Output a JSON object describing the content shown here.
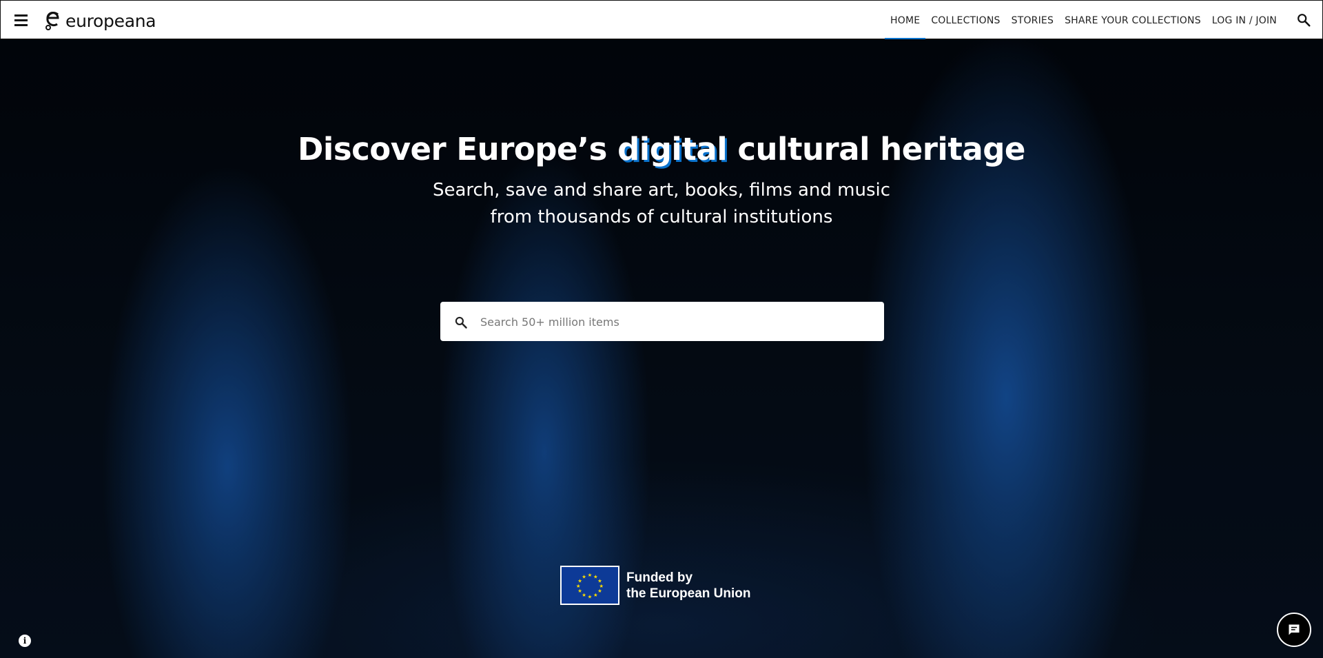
{
  "header": {
    "logo_text": "europeana",
    "nav": [
      {
        "label": "HOME",
        "active": true
      },
      {
        "label": "COLLECTIONS",
        "active": false
      },
      {
        "label": "STORIES",
        "active": false
      },
      {
        "label": "SHARE YOUR COLLECTIONS",
        "active": false
      },
      {
        "label": "LOG IN / JOIN",
        "active": false
      }
    ],
    "icons": {
      "menu": "hamburger-menu-icon",
      "search": "search-icon"
    }
  },
  "hero": {
    "title_part1": "Discover Europe’s ",
    "title_highlight": "digital",
    "title_part2": " cultural heritage",
    "subtitle_line1": "Search, save and share art, books, films and music",
    "subtitle_line2": "from thousands of cultural institutions",
    "search": {
      "placeholder": "Search 50+ million items",
      "value": ""
    }
  },
  "footer": {
    "eu_line1": "Funded by",
    "eu_line2": "the European Union",
    "icons": {
      "info": "info-icon",
      "feedback": "chat-feedback-icon"
    }
  },
  "colors": {
    "accent": "#0a72cc",
    "hero_tint": "#1656aa",
    "eu_flag": "#0d3a97"
  }
}
